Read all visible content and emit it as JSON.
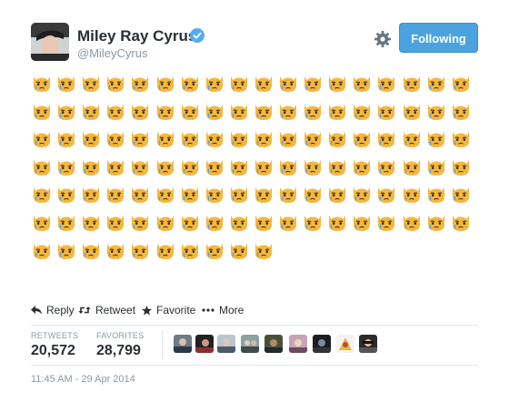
{
  "profile": {
    "name": "Miley Ray Cyrus",
    "handle": "@MileyCyrus",
    "verified": true
  },
  "header": {
    "follow_label": "Following",
    "settings_icon": "gear-icon"
  },
  "tweet": {
    "emoji_name": "crying-cat-face",
    "emoji_count": 118,
    "emoji_per_row": 18
  },
  "actions": {
    "reply": "Reply",
    "retweet": "Retweet",
    "favorite": "Favorite",
    "more": "More"
  },
  "stats": {
    "retweets_label": "RETWEETS",
    "retweets_value": "20,572",
    "favorites_label": "FAVORITES",
    "favorites_value": "28,799"
  },
  "favoriters_count": 9,
  "timestamp": "11:45 AM - 29 Apr 2014",
  "colors": {
    "accent": "#4aa3df",
    "muted": "#8899a6",
    "emoji_face": "#f4b73f",
    "tear": "#5ea6e0"
  }
}
